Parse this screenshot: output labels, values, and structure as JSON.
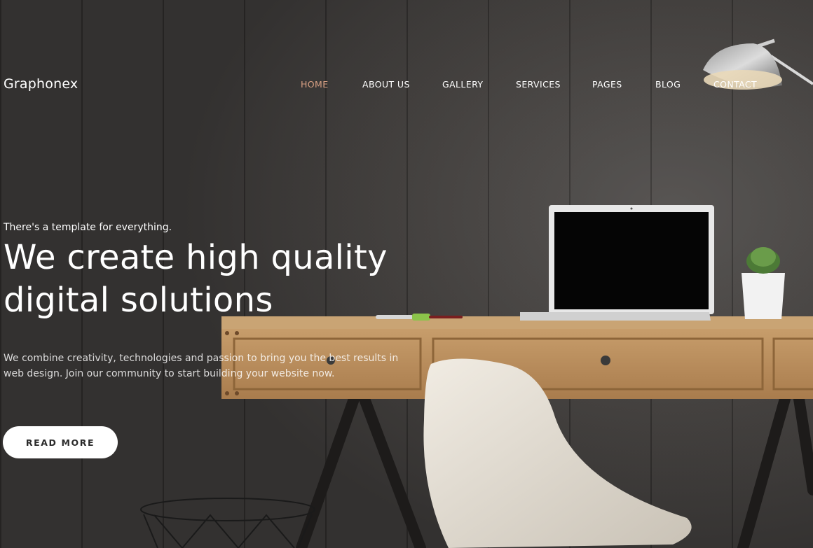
{
  "header": {
    "logo_text": "Graphonex",
    "nav": [
      {
        "label": "HOME",
        "active": true
      },
      {
        "label": "ABOUT US",
        "active": false
      },
      {
        "label": "GALLERY",
        "active": false
      },
      {
        "label": "SERVICES",
        "active": false
      },
      {
        "label": "PAGES",
        "active": false
      },
      {
        "label": "BLOG",
        "active": false
      },
      {
        "label": "CONTACT",
        "active": false
      }
    ]
  },
  "hero": {
    "kicker": "There's a template for everything.",
    "headline_line1": "We create high quality",
    "headline_line2": "digital solutions",
    "description_line1": "We combine creativity, technologies and passion to bring you the best results in",
    "description_line2": "web design. Join our community to start building your website now.",
    "button_label": "READ MORE"
  },
  "colors": {
    "accent": "#d9a184",
    "text": "#ffffff",
    "background": "#3a3837",
    "button_bg": "#ffffff"
  },
  "background_image": {
    "objects": [
      "desk-lamp",
      "laptop",
      "potted-plant",
      "wooden-desk",
      "white-chair",
      "wire-basket",
      "pen",
      "marker"
    ]
  }
}
